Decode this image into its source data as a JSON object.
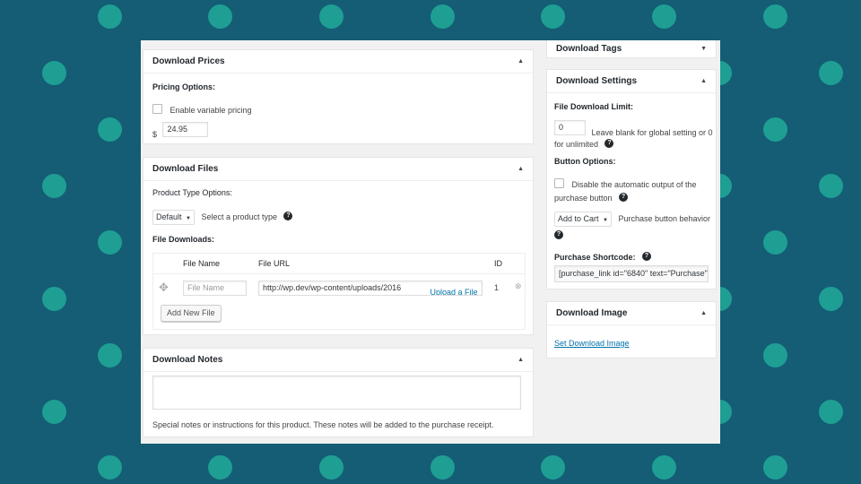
{
  "download_prices": {
    "title": "Download Prices",
    "pricing_options_label": "Pricing Options:",
    "variable_pricing_label": "Enable variable pricing",
    "currency_symbol": "$",
    "price_value": "24.95"
  },
  "download_files": {
    "title": "Download Files",
    "product_type_label": "Product Type Options:",
    "product_type_value": "Default",
    "product_type_hint": "Select a product type",
    "file_downloads_label": "File Downloads:",
    "columns": [
      "File Name",
      "File URL",
      "ID"
    ],
    "row": {
      "file_name_placeholder": "File Name",
      "file_url": "http://wp.dev/wp-content/uploads/2016",
      "upload_label": "Upload a File",
      "id": "1"
    },
    "add_new_label": "Add New File"
  },
  "download_notes": {
    "title": "Download Notes",
    "help_text": "Special notes or instructions for this product. These notes will be added to the purchase receipt."
  },
  "download_tags": {
    "title": "Download Tags"
  },
  "download_settings": {
    "title": "Download Settings",
    "limit_label": "File Download Limit:",
    "limit_value": "0",
    "limit_hint_1": "Leave blank for global setting or 0",
    "limit_hint_2": "for unlimited",
    "button_options_label": "Button Options:",
    "disable_output_line1": "Disable the automatic output of the",
    "disable_output_line2": "purchase button",
    "behavior_value": "Add to Cart",
    "behavior_hint": "Purchase button behavior",
    "shortcode_label": "Purchase Shortcode:",
    "shortcode_value": "[purchase_link id=\"6840\" text=\"Purchase\""
  },
  "download_image": {
    "title": "Download Image",
    "link_label": "Set Download Image"
  },
  "colors": {
    "background": "#145d74",
    "dots": "#1f9e94",
    "link": "#0073aa"
  }
}
